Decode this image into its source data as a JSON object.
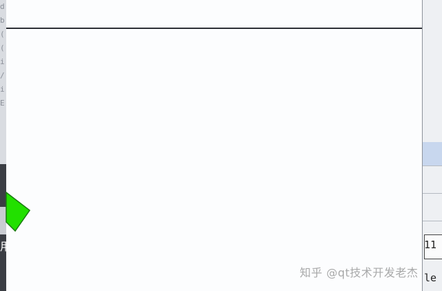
{
  "left_strip": {
    "fragments": [
      "d",
      "b",
      "(",
      "(",
      "i",
      "/",
      "i",
      "E"
    ],
    "bottom_glyph": "用"
  },
  "right_strip": {
    "cell_1": "11",
    "cell_2": "le"
  },
  "document": {
    "header_text": ""
  },
  "watermark": {
    "text": "知乎 @qt技术开发老杰"
  },
  "colors": {
    "arrow_fill": "#22e000",
    "arrow_stroke": "#1a7a10",
    "selection": "#c8d7ee"
  }
}
